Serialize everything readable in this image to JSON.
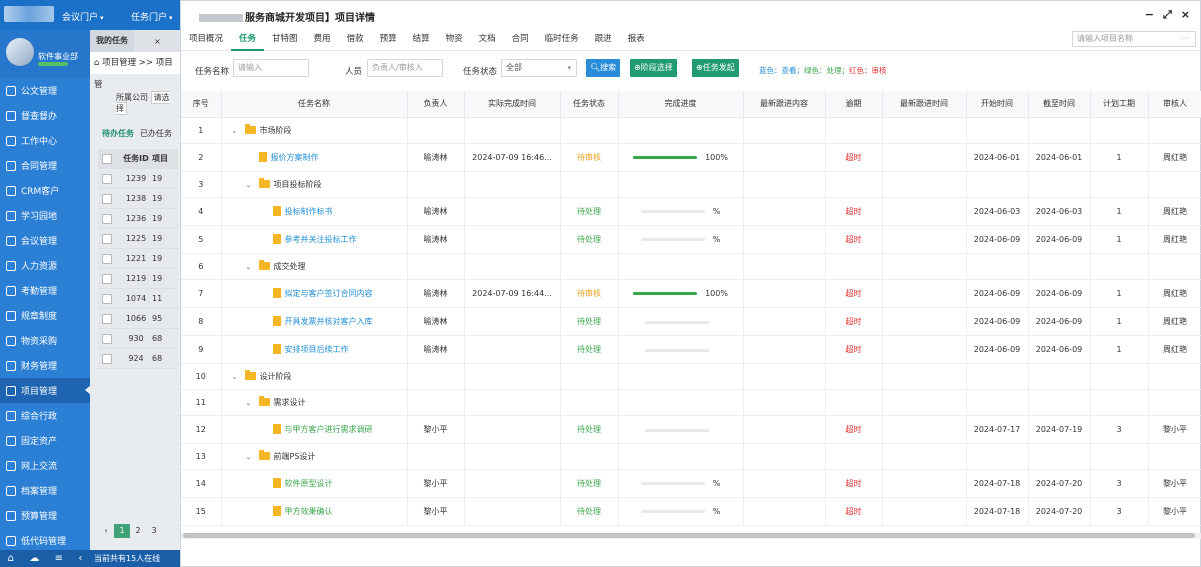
{
  "topbar": {
    "links": [
      "会议门户",
      "任务门户"
    ]
  },
  "sidebar": {
    "dept": "软件事业部",
    "items": [
      {
        "label": "公文管理",
        "icon": "document-icon"
      },
      {
        "label": "督查督办",
        "icon": "supervise-icon"
      },
      {
        "label": "工作中心",
        "icon": "monitor-icon"
      },
      {
        "label": "合同管理",
        "icon": "contract-icon"
      },
      {
        "label": "CRM客户",
        "icon": "crm-icon"
      },
      {
        "label": "学习园地",
        "icon": "study-icon"
      },
      {
        "label": "会议管理",
        "icon": "meeting-icon"
      },
      {
        "label": "人力资源",
        "icon": "hr-icon"
      },
      {
        "label": "考勤管理",
        "icon": "attendance-icon"
      },
      {
        "label": "规章制度",
        "icon": "rules-icon"
      },
      {
        "label": "物资采购",
        "icon": "purchase-icon"
      },
      {
        "label": "财务管理",
        "icon": "finance-icon"
      },
      {
        "label": "项目管理",
        "icon": "project-icon"
      },
      {
        "label": "综合行政",
        "icon": "admin-icon"
      },
      {
        "label": "固定资产",
        "icon": "assets-icon"
      },
      {
        "label": "网上交流",
        "icon": "chat-icon"
      },
      {
        "label": "档案管理",
        "icon": "archive-icon"
      },
      {
        "label": "预算管理",
        "icon": "budget-icon"
      },
      {
        "label": "低代码管理",
        "icon": "code-icon"
      }
    ],
    "online": "当前共有15人在线"
  },
  "bg": {
    "tab": "我的任务",
    "crumb": "项目管理 >> 项目管",
    "filter_label": "所属公司",
    "filter_value": "请选择",
    "tab_todo": "待办任务",
    "tab_done": "已办任务",
    "col_id": "任务ID",
    "col_2": "项目",
    "rows": [
      [
        "1239",
        "19"
      ],
      [
        "1238",
        "19"
      ],
      [
        "1236",
        "19"
      ],
      [
        "1225",
        "19"
      ],
      [
        "1221",
        "19"
      ],
      [
        "1219",
        "19"
      ],
      [
        "1074",
        "11"
      ],
      [
        "1066",
        "95"
      ],
      [
        "930",
        "68"
      ],
      [
        "924",
        "68"
      ]
    ],
    "pages": [
      "1",
      "2",
      "3"
    ]
  },
  "modal": {
    "title": "服务商城开发项目】项目详情",
    "tabs": [
      "项目概况",
      "任务",
      "甘特图",
      "费用",
      "借款",
      "预算",
      "结算",
      "物资",
      "文档",
      "合同",
      "临时任务",
      "跟进",
      "报表"
    ],
    "active_tab": 1,
    "search_placeholder": "请输入项目名称",
    "filter": {
      "name_label": "任务名称",
      "name_placeholder": "请输入",
      "person_label": "人员",
      "person_placeholder": "负责人/审核人",
      "status_label": "任务状态",
      "status_value": "全部",
      "btn_search": "搜索",
      "btn_stage": "阶段选择",
      "btn_start": "任务发起",
      "legend_blue": "蓝色：查看；",
      "legend_green": "绿色：处理；",
      "legend_red": "红色：审核"
    },
    "columns": [
      "序号",
      "任务名称",
      "负责人",
      "实际完成时间",
      "任务状态",
      "完成进度",
      "最新跟进内容",
      "逾期",
      "最新跟进时间",
      "开始时间",
      "截至时间",
      "计划工期",
      "审核人"
    ],
    "rows": [
      {
        "no": "1",
        "level": 0,
        "type": "group",
        "name": "市场阶段"
      },
      {
        "no": "2",
        "level": 1,
        "type": "task",
        "color": "blue",
        "name": "报价方案制作",
        "owner": "喻涛林",
        "done": "2024-07-09 16:46...",
        "status": "待审核",
        "status_color": "orange",
        "progress": 1.0,
        "pct": "100%",
        "overdue": "超时",
        "start": "2024-06-01",
        "end": "2024-06-01",
        "days": "1",
        "reviewer": "周红艳"
      },
      {
        "no": "3",
        "level": 1,
        "type": "group",
        "name": "项目投标阶段"
      },
      {
        "no": "4",
        "level": 2,
        "type": "task",
        "color": "blue",
        "name": "投标制作标书",
        "owner": "喻涛林",
        "done": "",
        "status": "待处理",
        "status_color": "green",
        "progress": 0,
        "pct": "%",
        "overdue": "超时",
        "start": "2024-06-03",
        "end": "2024-06-03",
        "days": "1",
        "reviewer": "周红艳"
      },
      {
        "no": "5",
        "level": 2,
        "type": "task",
        "color": "blue",
        "name": "参考并关注投标工作",
        "owner": "喻涛林",
        "done": "",
        "status": "待处理",
        "status_color": "green",
        "progress": 0,
        "pct": "%",
        "overdue": "超时",
        "start": "2024-06-09",
        "end": "2024-06-09",
        "days": "1",
        "reviewer": "周红艳"
      },
      {
        "no": "6",
        "level": 1,
        "type": "group",
        "name": "成交处理"
      },
      {
        "no": "7",
        "level": 2,
        "type": "task",
        "color": "blue",
        "name": "拟定与客户签订合同内容",
        "owner": "喻涛林",
        "done": "2024-07-09 16:44...",
        "status": "待审核",
        "status_color": "orange",
        "progress": 1.0,
        "pct": "100%",
        "overdue": "超时",
        "start": "2024-06-09",
        "end": "2024-06-09",
        "days": "1",
        "reviewer": "周红艳"
      },
      {
        "no": "8",
        "level": 2,
        "type": "task",
        "color": "blue",
        "name": "开具发票并核对客户入库",
        "owner": "喻涛林",
        "done": "",
        "status": "待处理",
        "status_color": "green",
        "progress": 0,
        "pct": "",
        "overdue": "超时",
        "start": "2024-06-09",
        "end": "2024-06-09",
        "days": "1",
        "reviewer": "周红艳"
      },
      {
        "no": "9",
        "level": 2,
        "type": "task",
        "color": "blue",
        "name": "安排项目后续工作",
        "owner": "喻涛林",
        "done": "",
        "status": "待处理",
        "status_color": "green",
        "progress": 0,
        "pct": "",
        "overdue": "超时",
        "start": "2024-06-09",
        "end": "2024-06-09",
        "days": "1",
        "reviewer": "周红艳"
      },
      {
        "no": "10",
        "level": 0,
        "type": "group",
        "name": "设计阶段"
      },
      {
        "no": "11",
        "level": 1,
        "type": "group",
        "name": "需求设计"
      },
      {
        "no": "12",
        "level": 2,
        "type": "task",
        "color": "green",
        "name": "与甲方客户进行需求调研",
        "owner": "黎小平",
        "done": "",
        "status": "待处理",
        "status_color": "green",
        "progress": 0,
        "pct": "",
        "overdue": "超时",
        "start": "2024-07-17",
        "end": "2024-07-19",
        "days": "3",
        "reviewer": "黎小平"
      },
      {
        "no": "13",
        "level": 1,
        "type": "group",
        "name": "前端PS设计"
      },
      {
        "no": "14",
        "level": 2,
        "type": "task",
        "color": "green",
        "name": "软件原型设计",
        "owner": "黎小平",
        "done": "",
        "status": "待处理",
        "status_color": "green",
        "progress": 0,
        "pct": "%",
        "overdue": "超时",
        "start": "2024-07-18",
        "end": "2024-07-20",
        "days": "3",
        "reviewer": "黎小平"
      },
      {
        "no": "15",
        "level": 2,
        "type": "task",
        "color": "green",
        "name": "甲方效果确认",
        "owner": "黎小平",
        "done": "",
        "status": "待处理",
        "status_color": "green",
        "progress": 0,
        "pct": "%",
        "overdue": "超时",
        "start": "2024-07-18",
        "end": "2024-07-20",
        "days": "3",
        "reviewer": "黎小平"
      }
    ]
  }
}
